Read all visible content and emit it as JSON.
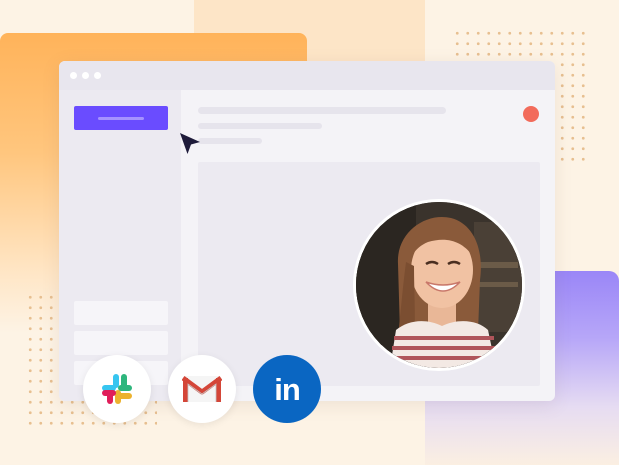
{
  "app_window": {
    "title_bar_dots": 3,
    "primary_button": {
      "label": ""
    },
    "sidebar_items": 3,
    "status_color": "#f26b5b",
    "accent_color": "#6a4cff"
  },
  "integrations": [
    {
      "name": "slack-icon"
    },
    {
      "name": "gmail-icon"
    },
    {
      "name": "linkedin-icon",
      "text": "in",
      "color": "#0a66c2"
    }
  ],
  "avatar": {
    "description_icon": "user-photo-avatar"
  }
}
